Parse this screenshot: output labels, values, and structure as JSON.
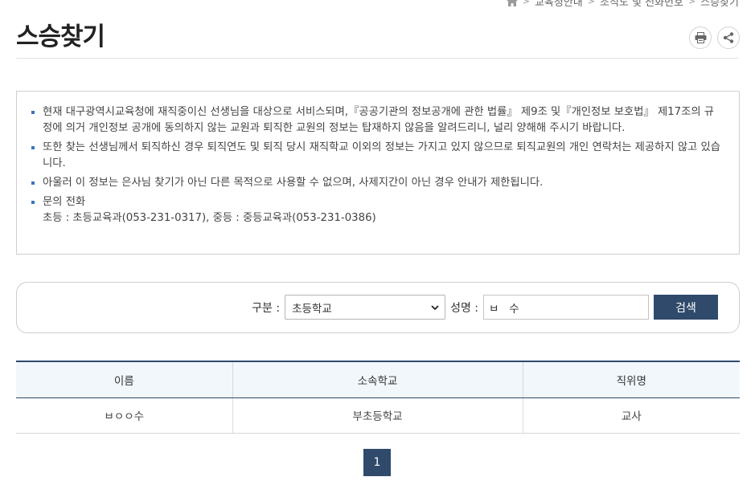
{
  "breadcrumb": {
    "home_icon": "home-icon",
    "items": [
      "교육청안내",
      "조직도 및 전화번호",
      "스승찾기"
    ]
  },
  "page": {
    "title": "스승찾기"
  },
  "tools": {
    "print_icon": "print-icon",
    "share_icon": "share-icon"
  },
  "notice": {
    "items": [
      "현재 대구광역시교육청에 재직중이신 선생님을 대상으로 서비스되며,『공공기관의 정보공개에 관한 법률』 제9조 및『개인정보 보호법』 제17조의 규정에 의거 개인정보 공개에 동의하지 않는 교원과 퇴직한 교원의 정보는 탑재하지 않음을 알려드리니, 널리 양해해 주시기 바랍니다.",
      "또한 찾는 선생님께서 퇴직하신 경우 퇴직연도 및 퇴직 당시 재직학교 이외의 정보는 가지고 있지 않으므로 퇴직교원의 개인 연락처는 제공하지 않고 있습니다.",
      "아울러 이 정보는 은사님 찾기가 아닌 다른 목적으로 사용할 수 없으며, 사제지간이 아닌 경우 안내가 제한됩니다."
    ],
    "contact_title": "문의 전화",
    "contact_detail": "초등 : 초등교육과(053-231-0317), 중등 : 중등교육과(053-231-0386)"
  },
  "search": {
    "category_label": "구분 :",
    "category_value": "초등학교",
    "name_label": "성명 :",
    "name_value": "ㅂ   수",
    "button_label": "검색"
  },
  "table": {
    "headers": [
      "이름",
      "소속학교",
      "직위명"
    ],
    "rows": [
      [
        "ㅂㅇㅇ수",
        "부초등학교",
        "교사"
      ]
    ]
  },
  "pagination": {
    "current": "1"
  },
  "colors": {
    "accent": "#2f4a6b",
    "bullet": "#3a76b8",
    "header_bg": "#f2f7fc"
  }
}
